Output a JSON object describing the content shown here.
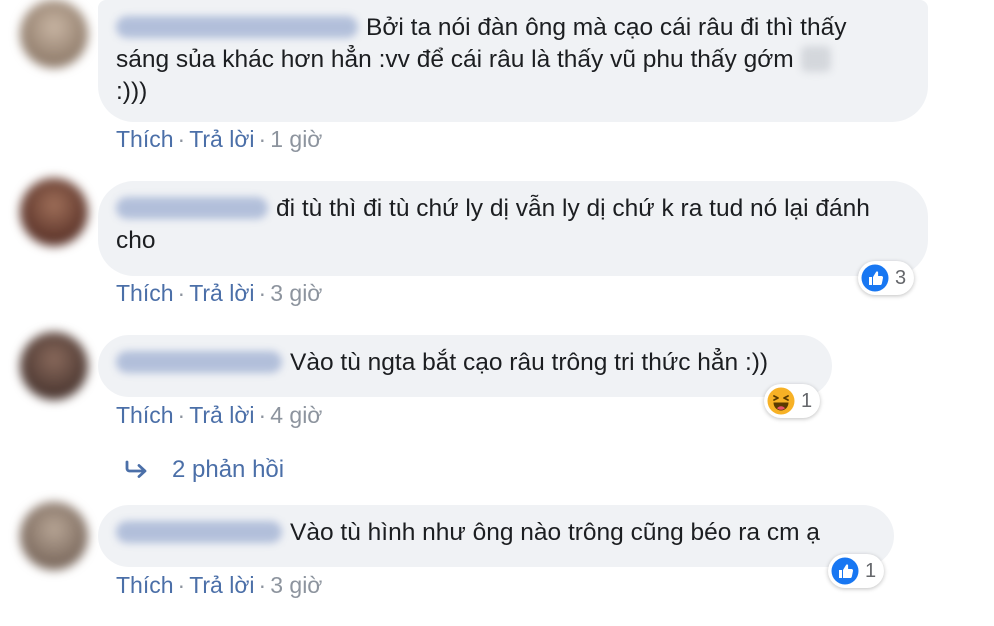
{
  "comments": [
    {
      "text": "Bởi ta nói đàn ông mà cạo cái râu đi thì thấy sáng sủa khác hơn hẳn :vv để cái râu là thấy vũ phu thấy gớm",
      "text_end": ":)))",
      "actions": {
        "like": "Thích",
        "reply": "Trả lời",
        "time": "1 giờ"
      }
    },
    {
      "text": "đi tù thì đi tù chứ ly dị vẫn ly dị chứ k ra tud nó lại đánh cho",
      "actions": {
        "like": "Thích",
        "reply": "Trả lời",
        "time": "3 giờ"
      },
      "reaction": {
        "icon": "like-icon",
        "count": "3"
      }
    },
    {
      "text": "Vào tù ngta bắt cạo râu trông tri thức hẳn :))",
      "actions": {
        "like": "Thích",
        "reply": "Trả lời",
        "time": "4 giờ"
      },
      "reaction": {
        "icon": "haha-icon",
        "count": "1"
      }
    },
    {
      "text": "Vào tù hình như ông nào trông cũng béo ra cm ạ",
      "actions": {
        "like": "Thích",
        "reply": "Trả lời",
        "time": "3 giờ"
      },
      "reaction": {
        "icon": "like-icon",
        "count": "1"
      }
    }
  ],
  "replies_link": {
    "icon": "reply-arrow-icon",
    "label": "2 phản hồi"
  },
  "separator": "·",
  "colors": {
    "link": "#4b6fa8",
    "bubble": "#f0f2f5",
    "like_blue": "#1877f2",
    "haha_yellow": "#f7b125"
  }
}
